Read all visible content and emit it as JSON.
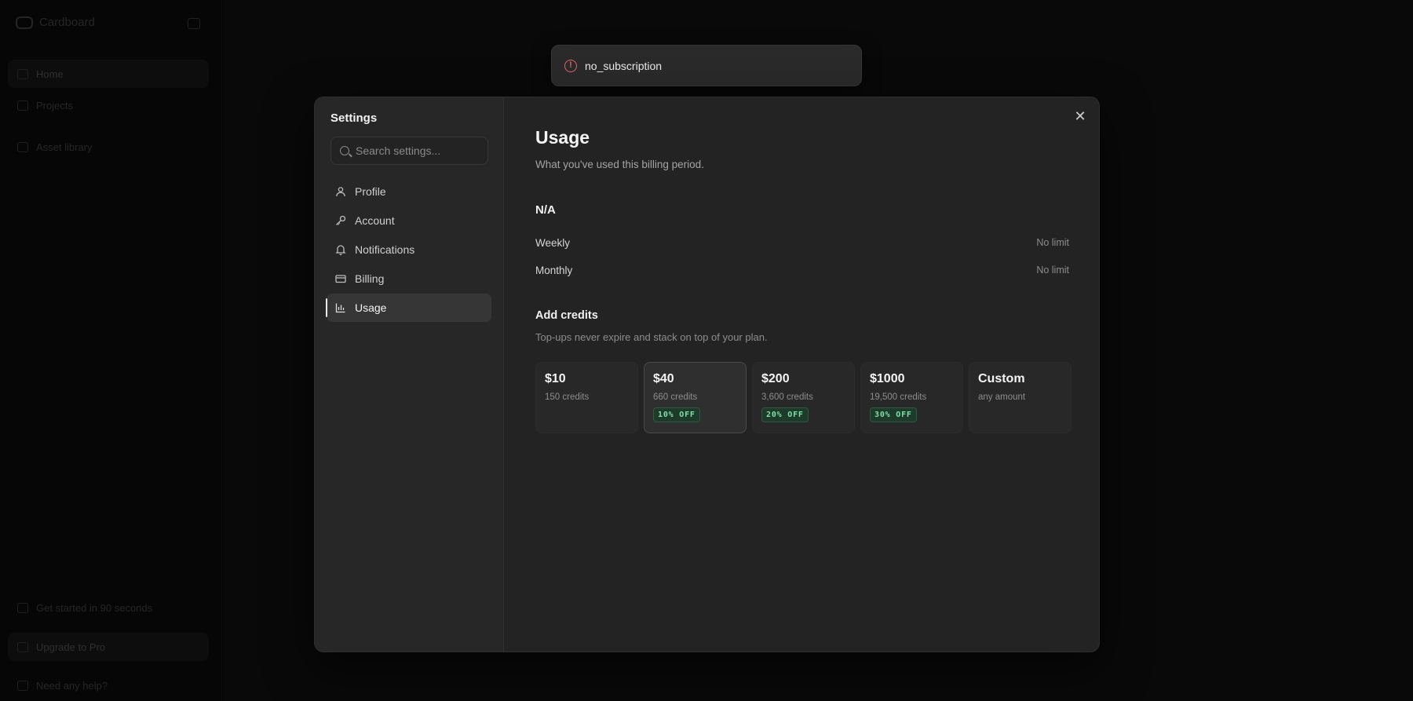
{
  "background": {
    "brand": "Cardboard",
    "nav": [
      {
        "label": "Home"
      },
      {
        "label": "Projects"
      },
      {
        "label": "Asset library"
      }
    ],
    "bottom": [
      {
        "label": "Get started in 90 seconds"
      },
      {
        "label": "Upgrade to Pro"
      },
      {
        "label": "Need any help?"
      }
    ]
  },
  "toast": {
    "icon": "alert-circle-icon",
    "message": "no_subscription",
    "color": "#e0646b"
  },
  "settings": {
    "title": "Settings",
    "search": {
      "placeholder": "Search settings..."
    },
    "nav": [
      {
        "label": "Profile",
        "icon": "user-icon"
      },
      {
        "label": "Account",
        "icon": "key-icon"
      },
      {
        "label": "Notifications",
        "icon": "bell-icon"
      },
      {
        "label": "Billing",
        "icon": "credit-card-icon"
      },
      {
        "label": "Usage",
        "icon": "bar-chart-icon",
        "active": true
      }
    ]
  },
  "usage": {
    "title": "Usage",
    "subtitle": "What you've used this billing period.",
    "plan": "N/A",
    "limits": [
      {
        "label": "Weekly",
        "value": "No limit"
      },
      {
        "label": "Monthly",
        "value": "No limit"
      }
    ],
    "credits": {
      "title": "Add credits",
      "subtitle": "Top-ups never expire and stack on top of your plan.",
      "options": [
        {
          "price": "$10",
          "credits": "150 credits",
          "badge": ""
        },
        {
          "price": "$40",
          "credits": "660 credits",
          "badge": "10% OFF",
          "selected": true
        },
        {
          "price": "$200",
          "credits": "3,600 credits",
          "badge": "20% OFF"
        },
        {
          "price": "$1000",
          "credits": "19,500 credits",
          "badge": "30% OFF"
        },
        {
          "price": "Custom",
          "credits": "any amount",
          "badge": ""
        }
      ]
    }
  }
}
